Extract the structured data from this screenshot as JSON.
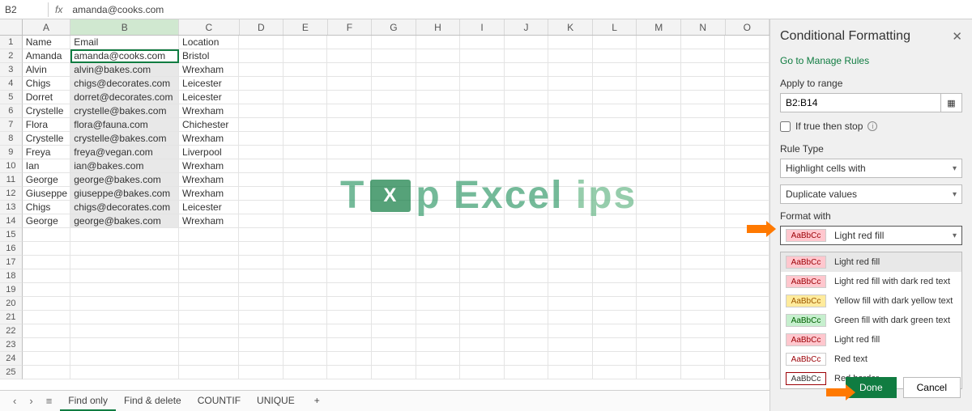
{
  "formula_bar": {
    "name_box": "B2",
    "fx_label": "fx",
    "value": "amanda@cooks.com"
  },
  "columns": [
    "A",
    "B",
    "C",
    "D",
    "E",
    "F",
    "G",
    "H",
    "I",
    "J",
    "K",
    "L",
    "M",
    "N",
    "O"
  ],
  "headers": {
    "A": "Name",
    "B": "Email",
    "C": "Location"
  },
  "rows": [
    {
      "n": "Amanda",
      "e": "amanda@cooks.com",
      "l": "Bristol"
    },
    {
      "n": "Alvin",
      "e": "alvin@bakes.com",
      "l": "Wrexham"
    },
    {
      "n": "Chigs",
      "e": "chigs@decorates.com",
      "l": "Leicester"
    },
    {
      "n": "Dorret",
      "e": "dorret@decorates.com",
      "l": "Leicester"
    },
    {
      "n": "Crystelle",
      "e": "crystelle@bakes.com",
      "l": "Wrexham"
    },
    {
      "n": "Flora",
      "e": "flora@fauna.com",
      "l": "Chichester"
    },
    {
      "n": "Crystelle",
      "e": "crystelle@bakes.com",
      "l": "Wrexham"
    },
    {
      "n": "Freya",
      "e": "freya@vegan.com",
      "l": "Liverpool"
    },
    {
      "n": "Ian",
      "e": "ian@bakes.com",
      "l": "Wrexham"
    },
    {
      "n": "George",
      "e": "george@bakes.com",
      "l": "Wrexham"
    },
    {
      "n": "Giuseppe",
      "e": "giuseppe@bakes.com",
      "l": "Wrexham"
    },
    {
      "n": "Chigs",
      "e": "chigs@decorates.com",
      "l": "Leicester"
    },
    {
      "n": "George",
      "e": "george@bakes.com",
      "l": "Wrexham"
    }
  ],
  "empty_row_count": 11,
  "tabs": {
    "items": [
      "Find only",
      "Find & delete",
      "COUNTIF",
      "UNIQUE"
    ],
    "active": 0,
    "plus": "+"
  },
  "panel": {
    "title": "Conditional Formatting",
    "manage_link": "Go to Manage Rules",
    "apply_label": "Apply to range",
    "range": "B2:B14",
    "if_true_label": "If true then stop",
    "rule_type_label": "Rule Type",
    "rule_type": "Highlight cells with",
    "rule_subtype": "Duplicate values",
    "format_label": "Format with",
    "selected_format": "Light red fill",
    "swatch_text": "AaBbCc",
    "options": [
      {
        "key": "lightred",
        "label": "Light red fill",
        "cls": "sw-lightred"
      },
      {
        "key": "lightreddark",
        "label": "Light red fill with dark red text",
        "cls": "sw-lightreddark"
      },
      {
        "key": "yellow",
        "label": "Yellow fill with dark yellow text",
        "cls": "sw-yellow"
      },
      {
        "key": "green",
        "label": "Green fill with dark green text",
        "cls": "sw-green"
      },
      {
        "key": "lightred2",
        "label": "Light red fill",
        "cls": "sw-lightred"
      },
      {
        "key": "redtext",
        "label": "Red text",
        "cls": "sw-redtext"
      },
      {
        "key": "redborder",
        "label": "Red border",
        "cls": "sw-redborder"
      }
    ],
    "done": "Done",
    "cancel": "Cancel"
  },
  "watermark": {
    "t1": "T",
    "t2": "p",
    "t3": "Excel",
    "t4": "ips"
  }
}
